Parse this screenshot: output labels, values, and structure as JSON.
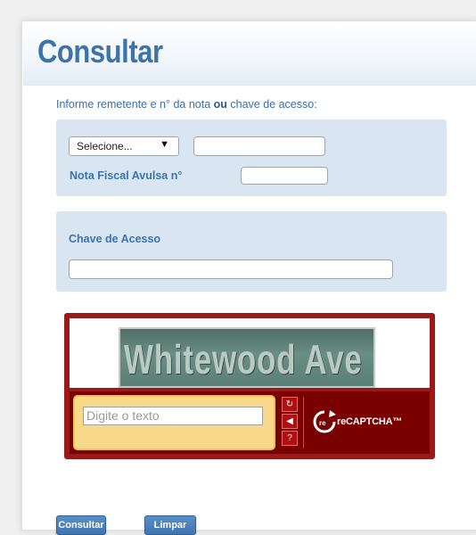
{
  "header": {
    "title": "Consultar"
  },
  "form": {
    "instruction_pre": "Informe remetente e n° da nota ",
    "instruction_bold": "ou",
    "instruction_post": " chave de acesso:",
    "select_value": "Selecione...",
    "select_caret": "▼",
    "numero_value": "",
    "avulsa_label": "Nota Fiscal Avulsa n°",
    "avulsa_value": "",
    "chave_label": "Chave de Acesso",
    "chave_value": ""
  },
  "captcha": {
    "challenge_text": "Whitewood Ave",
    "input_placeholder": "Digite o texto",
    "refresh_icon": "↻",
    "audio_icon": "◀",
    "help_icon": "?",
    "brand": "reCAPTCHA™",
    "colors": {
      "frame": "#9a1a1a",
      "bottom": "#7a0000",
      "input_area": "#f8d98a"
    }
  },
  "actions": {
    "consultar_label": "Consultar",
    "limpar_label": "Limpar"
  },
  "colors": {
    "accent": "#3b73ad",
    "section_bg": "#d9e6f2"
  }
}
